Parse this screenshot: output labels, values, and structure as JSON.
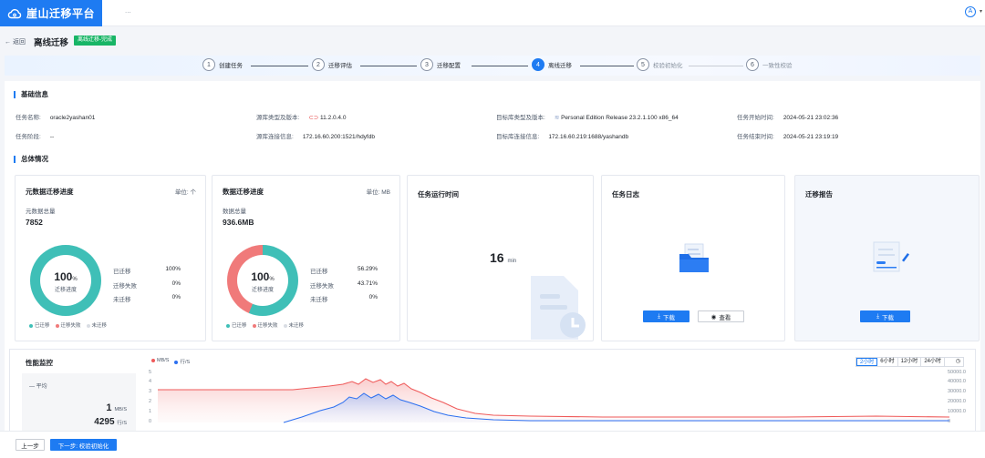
{
  "app": {
    "name": "崖山迁移平台",
    "top_dots": "..."
  },
  "header": {
    "back": "返回",
    "title": "离线迁移",
    "badge": "离线迁移-完成"
  },
  "steps": [
    {
      "num": "1",
      "label": "创建任务"
    },
    {
      "num": "2",
      "label": "迁移评估"
    },
    {
      "num": "3",
      "label": "迁移配置"
    },
    {
      "num": "4",
      "label": "离线迁移"
    },
    {
      "num": "5",
      "label": "校验初始化"
    },
    {
      "num": "6",
      "label": "一致性校验"
    }
  ],
  "basic": {
    "section": "基础信息",
    "fields": [
      {
        "k": "任务名称:",
        "v": "oracle2yashan01"
      },
      {
        "k": "源库类型及版本:",
        "v": "11.2.0.4.0"
      },
      {
        "k": "目标库类型及版本:",
        "v": "Personal Edition Release 23.2.1.100 x86_64"
      },
      {
        "k": "任务开始时间:",
        "v": "2024-05-21 23:02:36"
      },
      {
        "k": "任务阶段:",
        "v": "--"
      },
      {
        "k": "源库连接信息:",
        "v": "172.16.60.200:1521/hdyfdb"
      },
      {
        "k": "目标库连接信息:",
        "v": "172.16.60.219:1688/yashandb"
      },
      {
        "k": "任务结束时间:",
        "v": "2024-05-21 23:19:19"
      }
    ]
  },
  "overview": {
    "section": "总体情况",
    "meta": {
      "title": "元数据迁移进度",
      "unit": "单位: 个",
      "sub": "元数据总量",
      "total": "7852",
      "pct": "100",
      "pct_unit": "%",
      "caption": "迁移进度",
      "rows": [
        {
          "k": "已迁移",
          "v": "100%"
        },
        {
          "k": "迁移失败",
          "v": "0%"
        },
        {
          "k": "未迁移",
          "v": "0%"
        }
      ],
      "migrated_fraction": 1.0
    },
    "data": {
      "title": "数据迁移进度",
      "unit": "单位: MB",
      "sub": "数据总量",
      "total": "936.6MB",
      "pct": "100",
      "pct_unit": "%",
      "caption": "迁移进度",
      "rows": [
        {
          "k": "已迁移",
          "v": "56.29%"
        },
        {
          "k": "迁移失败",
          "v": "43.71%"
        },
        {
          "k": "未迁移",
          "v": "0%"
        }
      ],
      "migrated_fraction": 0.5629
    },
    "legend": [
      "已迁移",
      "迁移失败",
      "未迁移"
    ],
    "runtime": {
      "title": "任务运行时间",
      "value": "16",
      "unit": "min"
    },
    "log": {
      "title": "任务日志",
      "download": "下载",
      "view": "查看"
    },
    "report": {
      "title": "迁移报告",
      "download": "下载"
    }
  },
  "perf": {
    "title": "性能监控",
    "legend": [
      "MB/S",
      "行/S"
    ],
    "avg_label": "平均",
    "avg_mb": "1",
    "avg_mb_unit": "MB/S",
    "avg_rows": "4295",
    "avg_rows_unit": "行/S",
    "ranges": [
      "2小时",
      "6小时",
      "12小时",
      "24小时"
    ],
    "left_ticks": [
      "5",
      "4",
      "3",
      "2",
      "1",
      "0"
    ],
    "right_ticks": [
      "50000.0",
      "40000.0",
      "30000.0",
      "20000.0",
      "10000.0",
      "0"
    ]
  },
  "colors": {
    "primary": "#1e7bf2",
    "teal": "#3fbfb7",
    "red": "#f07a7a",
    "green": "#18b566"
  },
  "footer": {
    "prev": "上一步",
    "next": "下一步: 校验初始化"
  }
}
